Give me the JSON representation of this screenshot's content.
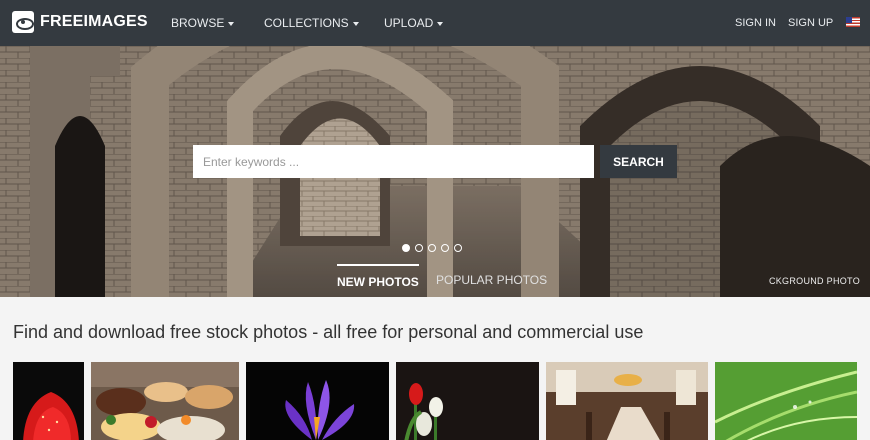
{
  "navbar": {
    "logo_text": "FREEIMAGES",
    "browse": "BROWSE",
    "collections": "COLLECTIONS",
    "upload": "UPLOAD",
    "sign_in": "SIGN IN",
    "sign_up": "SIGN UP",
    "language_flag": "us-flag-icon"
  },
  "hero": {
    "search_placeholder": "Enter keywords ...",
    "search_button": "SEARCH",
    "slides_total": 5,
    "slide_active": 1,
    "tabs": [
      "NEW PHOTOS",
      "POPULAR PHOTOS"
    ],
    "background_credit": "CKGROUND PHOTO"
  },
  "main": {
    "tagline": "Find and download free stock photos - all free for personal and commercial use",
    "thumbnails": [
      "strawberry",
      "pastries",
      "purple-crocus",
      "tulips",
      "dining-room",
      "green-plant"
    ]
  }
}
